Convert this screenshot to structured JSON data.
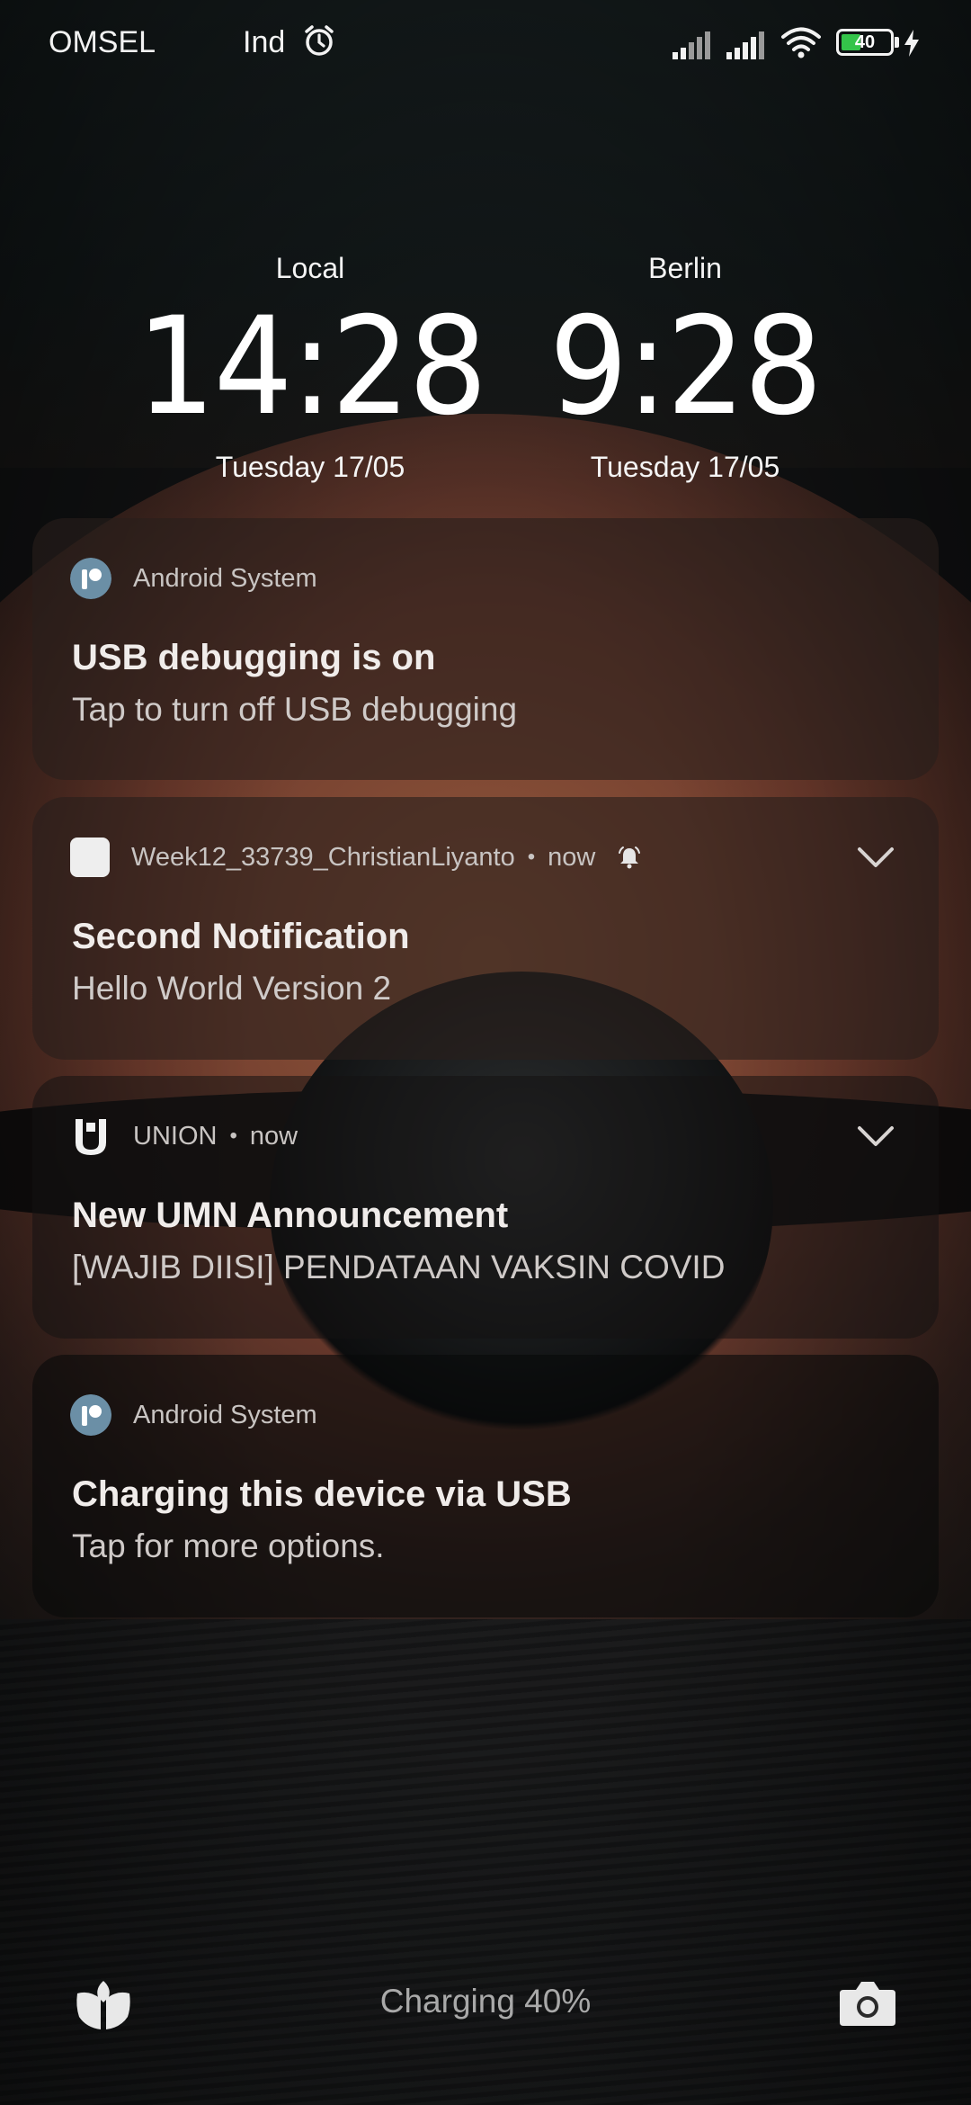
{
  "status_bar": {
    "carrier_1": "OMSEL",
    "carrier_2": "Ind",
    "battery_level": "40",
    "battery_fraction": 0.4,
    "icons": [
      "alarm-icon",
      "signal-1-icon",
      "signal-2-icon",
      "wifi-icon",
      "battery-icon",
      "charging-bolt-icon"
    ]
  },
  "clocks": [
    {
      "city": "Local",
      "time": "14:28",
      "date": "Tuesday 17/05"
    },
    {
      "city": "Berlin",
      "time": "9:28",
      "date": "Tuesday 17/05"
    }
  ],
  "notifications": [
    {
      "app": "Android System",
      "title": "USB debugging is on",
      "text": "Tap to turn off USB debugging",
      "icon": "android-system-icon"
    },
    {
      "app": "Week12_33739_ChristianLiyanto",
      "time": "now",
      "title": "Second Notification",
      "text": "Hello World Version 2",
      "icon": "app-icon",
      "extra_icon": "bell-icon"
    },
    {
      "app": "UNION",
      "time": "now",
      "title": "New UMN Announcement",
      "text": "[WAJIB DIISI] PENDATAAN VAKSIN COVID",
      "icon": "union-icon"
    },
    {
      "app": "Android System",
      "title": "Charging this device via USB",
      "text": "Tap for more options.",
      "icon": "android-system-icon"
    }
  ],
  "bottom": {
    "charging_text": "Charging 40%",
    "left_icon": "shortcut-icon",
    "right_icon": "camera-icon"
  },
  "colors": {
    "battery_fill": "#34c44a",
    "android_icon": "#6b8fa6"
  }
}
